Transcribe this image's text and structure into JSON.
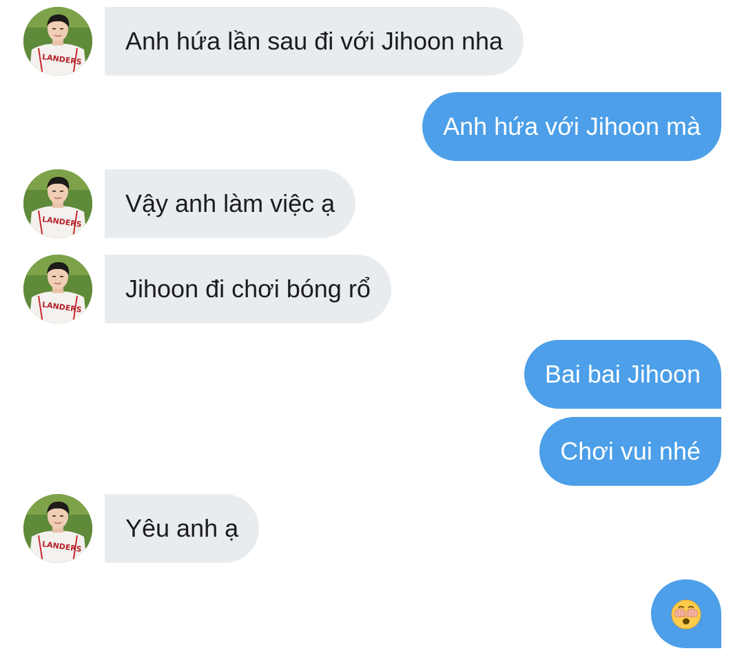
{
  "messages": [
    {
      "side": "in",
      "text": "Anh hứa lần sau đi với Jihoon nha"
    },
    {
      "side": "out",
      "text": "Anh hứa với Jihoon mà"
    },
    {
      "side": "in",
      "text": "Vậy anh làm việc ạ"
    },
    {
      "side": "in",
      "text": "Jihoon đi chơi bóng rổ"
    },
    {
      "side": "out",
      "text": "Bai bai Jihoon"
    },
    {
      "side": "out",
      "text": "Chơi vui nhé"
    },
    {
      "side": "in",
      "text": "Yêu anh ạ"
    },
    {
      "side": "out",
      "emoji": "see-no-evil-face-emoji"
    }
  ],
  "avatar": {
    "jersey_text": "LANDERS",
    "icon": "contact-avatar"
  },
  "colors": {
    "incoming_bubble": "#e9ecef",
    "outgoing_bubble": "#4c9fe8",
    "incoming_text": "#1c1c1e",
    "outgoing_text": "#ffffff"
  }
}
